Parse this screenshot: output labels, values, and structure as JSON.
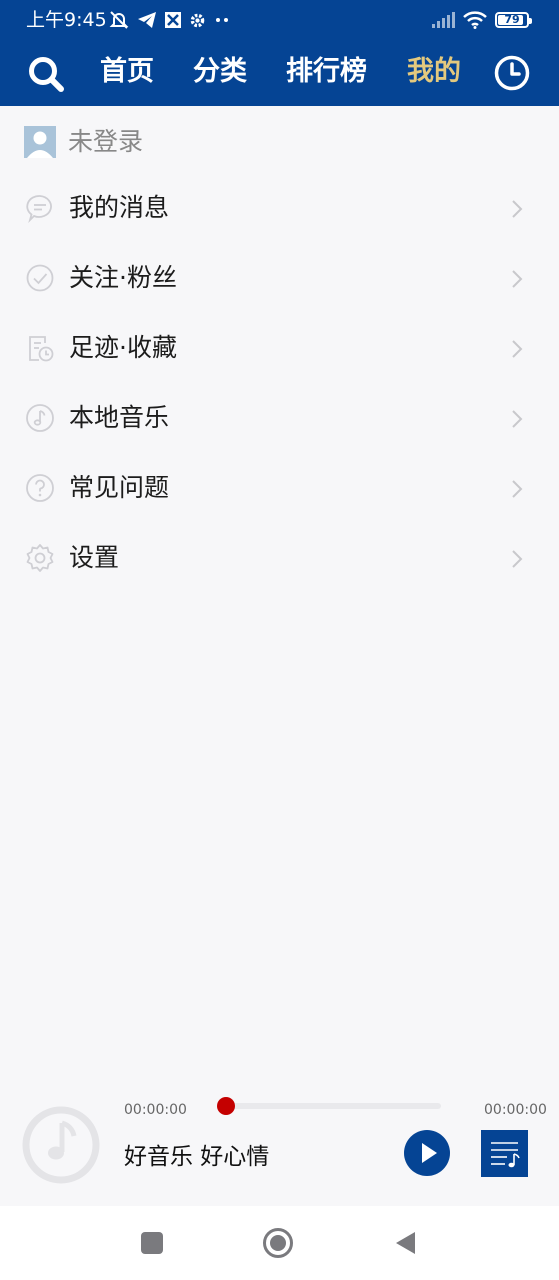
{
  "status_bar": {
    "time": "上午9:45",
    "battery": "79",
    "left_icons": [
      "muted-bell-icon",
      "telegram-icon",
      "app-icon",
      "gear-icon",
      "more-dots-icon"
    ],
    "right_icons": [
      "signal-icon",
      "wifi-icon",
      "battery-icon"
    ]
  },
  "nav": {
    "tabs": [
      {
        "label": "首页",
        "active": false
      },
      {
        "label": "分类",
        "active": false
      },
      {
        "label": "排行榜",
        "active": false
      },
      {
        "label": "我的",
        "active": true
      }
    ],
    "colors": {
      "background": "#054494",
      "active_tab": "#e3c97e",
      "tab": "#ffffff"
    }
  },
  "user": {
    "name": "未登录"
  },
  "menu": {
    "items": [
      {
        "label": "我的消息",
        "icon": "message-icon"
      },
      {
        "label": "关注·粉丝",
        "icon": "check-circle-icon"
      },
      {
        "label": "足迹·收藏",
        "icon": "history-document-icon"
      },
      {
        "label": "本地音乐",
        "icon": "music-note-icon"
      },
      {
        "label": "常见问题",
        "icon": "question-icon"
      },
      {
        "label": "设置",
        "icon": "settings-icon"
      }
    ]
  },
  "player": {
    "time_start": "00:00:00",
    "time_end": "00:00:00",
    "progress": 0,
    "song_title": "好音乐 好心情",
    "accent_color": "#c40000"
  }
}
